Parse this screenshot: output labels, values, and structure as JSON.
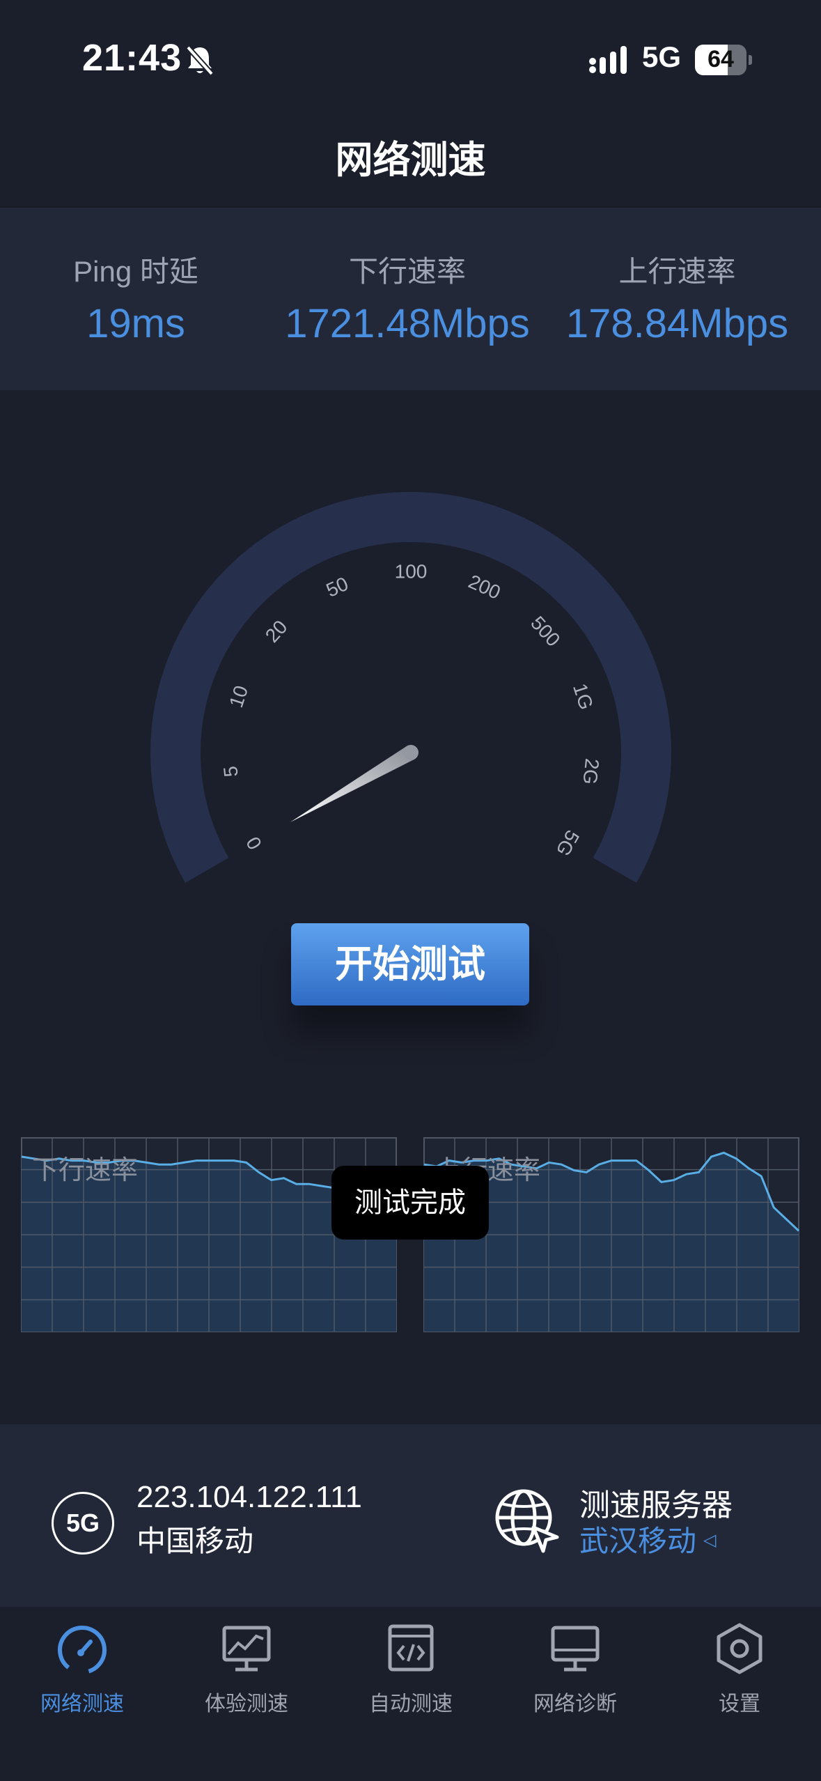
{
  "status": {
    "time": "21:43",
    "network": "5G",
    "battery": "64",
    "battery_level": 0.64
  },
  "title": "网络测速",
  "stats": [
    {
      "label": "Ping 时延",
      "value": "19ms"
    },
    {
      "label": "下行速率",
      "value": "1721.48Mbps"
    },
    {
      "label": "上行速率",
      "value": "178.84Mbps"
    }
  ],
  "gauge": {
    "ticks": [
      "0",
      "5",
      "10",
      "20",
      "50",
      "100",
      "200",
      "500",
      "1G",
      "2G",
      "5G"
    ],
    "needle_value": "0"
  },
  "start_button": "开始测试",
  "charts": {
    "download_label": "下行速率",
    "upload_label": "上行速率",
    "download_level": [
      0.9,
      0.89,
      0.88,
      0.89,
      0.88,
      0.88,
      0.87,
      0.87,
      0.88,
      0.88,
      0.87,
      0.86,
      0.86,
      0.87,
      0.88,
      0.88,
      0.88,
      0.88,
      0.87,
      0.82,
      0.78,
      0.79,
      0.76,
      0.76,
      0.75,
      0.74,
      0.73,
      0.73,
      0.72,
      0.71,
      0.7
    ],
    "upload_level": [
      0.86,
      0.85,
      0.88,
      0.87,
      0.88,
      0.88,
      0.89,
      0.86,
      0.85,
      0.84,
      0.87,
      0.86,
      0.83,
      0.82,
      0.86,
      0.88,
      0.88,
      0.88,
      0.83,
      0.77,
      0.78,
      0.81,
      0.82,
      0.9,
      0.92,
      0.89,
      0.84,
      0.8,
      0.64,
      0.58,
      0.52
    ]
  },
  "toast": "测试完成",
  "info": {
    "badge": "5G",
    "ip": "223.104.122.111",
    "carrier": "中国移动",
    "server_title": "测速服务器",
    "server_name": "武汉移动"
  },
  "tabs": [
    {
      "label": "网络测速",
      "icon": "speedometer-icon",
      "active": true
    },
    {
      "label": "体验测速",
      "icon": "chart-monitor-icon",
      "active": false
    },
    {
      "label": "自动测速",
      "icon": "code-window-icon",
      "active": false
    },
    {
      "label": "网络诊断",
      "icon": "monitor-icon",
      "active": false
    },
    {
      "label": "设置",
      "icon": "hexagon-gear-icon",
      "active": false
    }
  ],
  "colors": {
    "accent": "#4a8fe0",
    "background": "#1b1f2b",
    "panel": "#222838",
    "chart_line": "#5aaee6"
  }
}
